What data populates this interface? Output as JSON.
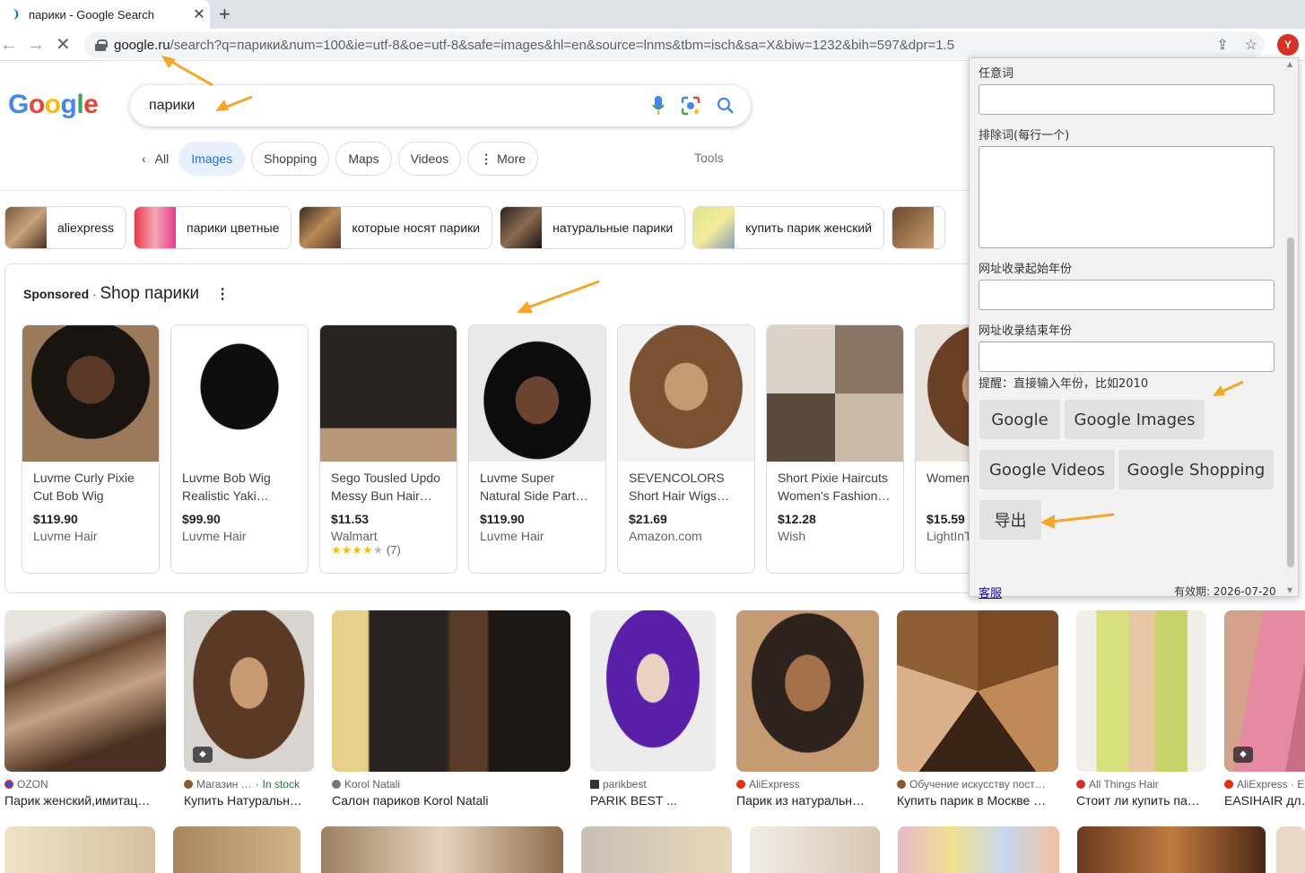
{
  "browser": {
    "tab_title": "парики - Google Search",
    "url_domain": "google.ru",
    "url_path": "/search?q=парики&num=100&ie=utf-8&oe=utf-8&safe=images&hl=en&source=lnms&tbm=isch&sa=X&biw=1232&bih=597&dpr=1.5",
    "profile_initial": "Y"
  },
  "google": {
    "logo": [
      "G",
      "o",
      "o",
      "g",
      "l",
      "e"
    ],
    "logo_colors": [
      "#4285f4",
      "#ea4335",
      "#fbbc05",
      "#4285f4",
      "#34a853",
      "#ea4335"
    ],
    "query": "парики",
    "filters": [
      "All",
      "Images",
      "Shopping",
      "Maps",
      "Videos",
      "More"
    ],
    "tools": "Tools"
  },
  "related": [
    "aliexpress",
    "парики цветные",
    "которые носят парики",
    "натуральные парики",
    "купить парик женский"
  ],
  "sponsored": {
    "label": "Sponsored",
    "title": "Shop парики",
    "products": [
      {
        "name": "Luvme Curly Pixie Cut Bob Wig Wate…",
        "price": "$119.90",
        "store": "Luvme Hair"
      },
      {
        "name": "Luvme Bob Wig Realistic Yaki…",
        "price": "$99.90",
        "store": "Luvme Hair"
      },
      {
        "name": "Sego Tousled Updo Messy Bun Hair…",
        "price": "$11.53",
        "store": "Walmart",
        "rating": 4,
        "reviews": "(7)"
      },
      {
        "name": "Luvme Super Natural Side Part…",
        "price": "$119.90",
        "store": "Luvme Hair"
      },
      {
        "name": "SEVENCOLORS Short Hair Wigs…",
        "price": "$21.69",
        "store": "Amazon.com"
      },
      {
        "name": "Short Pixie Haircuts Women's Fashion…",
        "price": "$12.28",
        "store": "Wish"
      },
      {
        "name": "Women's Wig Asy…",
        "price": "$15.59",
        "store": "LightInT…"
      }
    ]
  },
  "images": [
    {
      "source": "OZON",
      "caption": "Парик женский,имитац…",
      "stock": ""
    },
    {
      "source": "Магазин …",
      "caption": "Купить Натуральн…",
      "stock": "In stock"
    },
    {
      "source": "Korol Natali",
      "caption": "Салон париков Korol Natali",
      "stock": ""
    },
    {
      "source": "parikbest",
      "caption": "PARIK BEST ...",
      "stock": ""
    },
    {
      "source": "AliExpress",
      "caption": "Парик из натуральн…",
      "stock": ""
    },
    {
      "source": "Обучение искусству пост…",
      "caption": "Купить парик в Москве …",
      "stock": ""
    },
    {
      "source": "All Things Hair",
      "caption": "Стоит ли купить па…",
      "stock": ""
    },
    {
      "source": "AliExpress · E",
      "caption": "EASIHAIR дл…",
      "stock": ""
    }
  ],
  "popup": {
    "any_words_label": "任意词",
    "exclude_words_label": "排除词(每行一个)",
    "start_year_label": "网址收录起始年份",
    "end_year_label": "网址收录结束年份",
    "hint": "提醒：直接输入年份，比如2010",
    "btn_google": "Google",
    "btn_google_images": "Google Images",
    "btn_google_videos": "Google Videos",
    "btn_google_shopping": "Google Shopping",
    "btn_export": "导出",
    "support_link": "客服",
    "expiry": "有效期: 2026-07-20"
  },
  "colors": {
    "accent": "#1a73e8",
    "arrow": "#f5a623"
  },
  "icons": [
    "back-icon",
    "forward-icon",
    "stop-icon",
    "lock-icon",
    "share-icon",
    "star-icon",
    "mic-icon",
    "lens-icon",
    "search-icon",
    "more-dots-icon",
    "tag-icon"
  ]
}
